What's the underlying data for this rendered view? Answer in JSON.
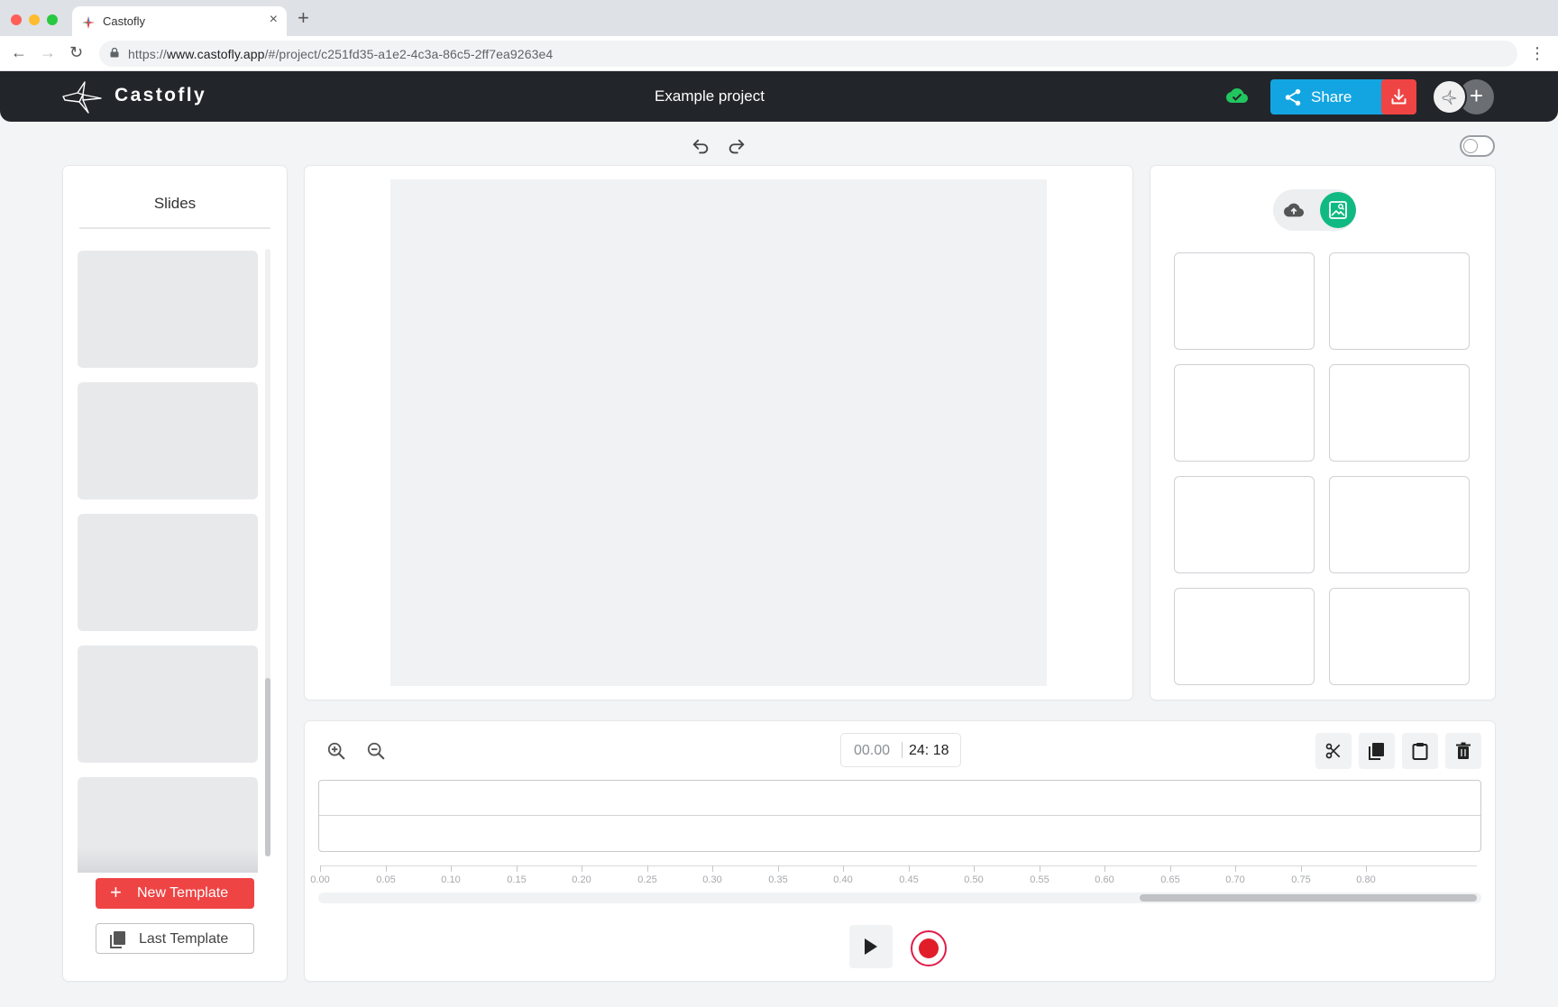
{
  "browser": {
    "tab_title": "Castofly",
    "url_scheme": "https://",
    "url_host": "www.castofly.app",
    "url_path": "/#/project/c251fd35-a1e2-4c3a-86c5-2ff7ea9263e4",
    "new_tab_label": "+",
    "close_tab_label": "×"
  },
  "header": {
    "brand": "Castofly",
    "project_title": "Example project",
    "share_label": "Share",
    "add_collaborator_label": "+",
    "sync_status": "saved-to-cloud",
    "accent_share": "#13a5e2",
    "accent_download": "#ef4444"
  },
  "slides": {
    "title": "Slides",
    "thumbnail_count": 5,
    "new_template_label": "New Template",
    "last_template_label": "Last Template"
  },
  "media": {
    "tabs": [
      "upload-cloud-icon",
      "image-library-icon"
    ],
    "active_tab": "image-library-icon",
    "tile_count": 8
  },
  "timeline": {
    "current_time": "00.00",
    "total_time": "24: 18",
    "ruler_labels": [
      "0.00",
      "0.05",
      "0.10",
      "0.15",
      "0.20",
      "0.25",
      "0.30",
      "0.35",
      "0.40",
      "0.45",
      "0.50",
      "0.55",
      "0.60",
      "0.65",
      "0.70",
      "0.75",
      "0.80"
    ],
    "tools": [
      "scissors-icon",
      "copy-icon",
      "paste-icon",
      "trash-icon"
    ],
    "record_color": "#e11d2a"
  },
  "settings": {
    "toggle_on": false
  }
}
